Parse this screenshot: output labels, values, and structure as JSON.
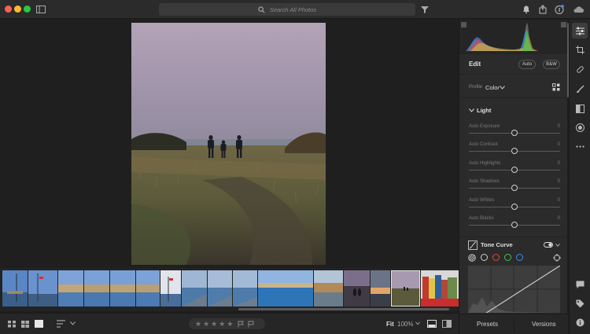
{
  "titlebar": {
    "search_placeholder": "Search All Photos"
  },
  "edit": {
    "title": "Edit",
    "auto_label": "Auto",
    "bw_label": "B&W",
    "profile_label": "Profile",
    "profile_value": "Color"
  },
  "light": {
    "title": "Light",
    "sliders": [
      {
        "label": "Auto Exposure",
        "value": "0",
        "level": 0.5
      },
      {
        "label": "Auto Contrast",
        "value": "0",
        "level": 0.5
      },
      {
        "label": "Auto Highlights",
        "value": "0",
        "level": 0.5
      },
      {
        "label": "Auto Shadows",
        "value": "0",
        "level": 0.5
      },
      {
        "label": "Auto Whites",
        "value": "0",
        "level": 0.5
      },
      {
        "label": "Auto Blacks",
        "value": "0",
        "level": 0.5
      }
    ]
  },
  "tone_curve": {
    "title": "Tone Curve",
    "channel_colors": [
      "#cfcfcf",
      "#e04848",
      "#4fbf4f",
      "#3a8fe6"
    ]
  },
  "bottombar": {
    "fit_label": "Fit",
    "zoom_label": "100%",
    "rating": 0
  },
  "panel_footer": {
    "presets_label": "Presets",
    "versions_label": "Versions"
  },
  "colors": {
    "accent_blue": "#3a8fe6",
    "notification_dot": "#2f8ff0"
  }
}
